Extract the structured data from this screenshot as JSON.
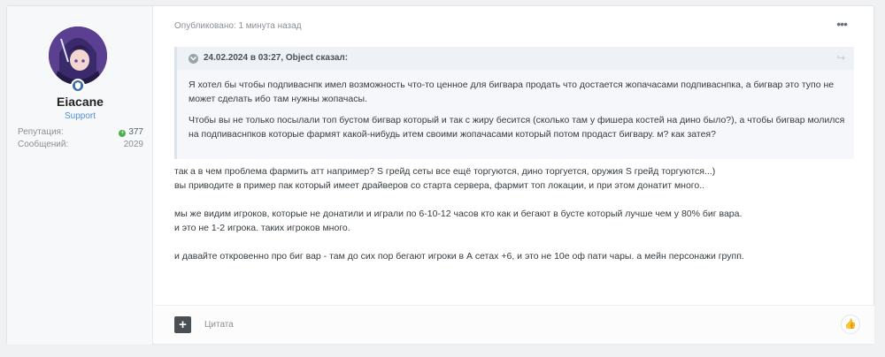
{
  "author": {
    "username": "Eiacane",
    "group": "Support",
    "stats": [
      {
        "label": "Репутация:",
        "value": "377"
      },
      {
        "label": "Сообщений:",
        "value": "2029"
      }
    ]
  },
  "post": {
    "meta": "Опубликовано: 1 минута назад",
    "menu_icon": "ellipsis-icon",
    "quote": {
      "title": "24.02.2024 в 03:27, Object сказал:",
      "paragraphs": [
        "Я хотел бы чтобы подпиваснпк имел возможность что-то ценное для бигвара продать что достается жопачасами подпиваснпка, а бигвар это тупо не может сделать ибо там нужны жопачасы.",
        "Чтобы вы не только посылали топ бустом бигвар который и так с жиру бесится (сколько там у фишера костей на дино было?), а чтобы бигвар молился на подпиваснпков которые фармят какой-нибудь итем своими жопачасами который потом продаст бигвару. м? как затея?"
      ]
    },
    "lines": [
      "так а в чем проблема фармить атт например? S грейд сеты все ещё торгуются, дино торгуется, оружия S грейд торгуются...)",
      "вы приводите в пример пак который имеет драйверов со старта сервера, фармит топ локации, и при этом донатит много..",
      "",
      "мы же видим игроков, которые не донатили и играли по 6-10-12 часов кто как и бегают в бусте который лучше чем у 80% биг вара.",
      "и это не 1-2 игрока. таких  игроков много.",
      "",
      "и давайте откровенно про биг вар - там до сих пор бегают игроки в А сетах +6, и это не 10е оф пати чары. а мейн персонажи групп."
    ]
  },
  "footer": {
    "add_label": "+",
    "cite_label": "Цитата",
    "like_icon": "thumbs-up-icon"
  }
}
